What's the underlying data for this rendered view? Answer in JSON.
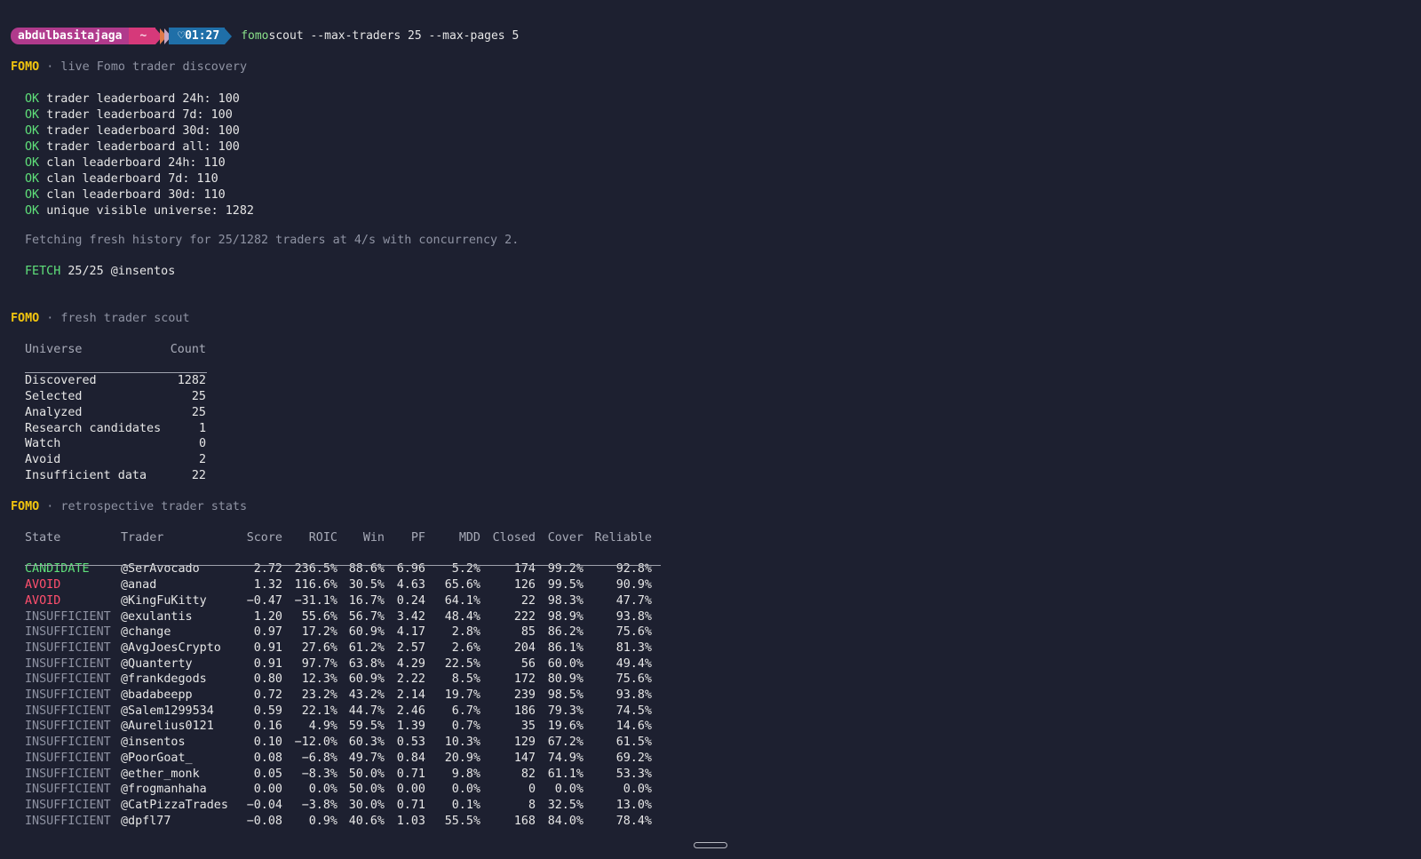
{
  "prompt": {
    "user": "abdulbasitajaga",
    "dir": "~",
    "time": "01:27",
    "command": "fomo",
    "args": " scout --max-traders 25 --max-pages 5"
  },
  "section1": {
    "brand": "FOMO",
    "title": " · live Fomo trader discovery"
  },
  "ok_lines": [
    "trader leaderboard 24h: 100",
    "trader leaderboard 7d: 100",
    "trader leaderboard 30d: 100",
    "trader leaderboard all: 100",
    "clan leaderboard 24h: 110",
    "clan leaderboard 7d: 110",
    "clan leaderboard 30d: 110",
    "unique visible universe: 1282"
  ],
  "ok_label": "OK",
  "fetch_info": "Fetching fresh history for 25/1282 traders at 4/s with concurrency 2.",
  "fetch": {
    "label": "FETCH",
    "text": " 25/25 @insentos"
  },
  "section2": {
    "brand": "FOMO",
    "title": " · fresh trader scout"
  },
  "universe": {
    "headers": [
      "Universe",
      "Count"
    ],
    "rows": [
      [
        "Discovered",
        "1282"
      ],
      [
        "Selected",
        "25"
      ],
      [
        "Analyzed",
        "25"
      ],
      [
        "Research candidates",
        "1"
      ],
      [
        "Watch",
        "0"
      ],
      [
        "Avoid",
        "2"
      ],
      [
        "Insufficient data",
        "22"
      ]
    ]
  },
  "section3": {
    "brand": "FOMO",
    "title": " · retrospective trader stats"
  },
  "stats": {
    "headers": [
      "State",
      "Trader",
      "Score",
      "ROIC",
      "Win",
      "PF",
      "MDD",
      "Closed",
      "Cover",
      "Reliable"
    ],
    "rows": [
      [
        "CANDIDATE",
        "@SerAvocado",
        "2.72",
        "236.5%",
        "88.6%",
        "6.96",
        "5.2%",
        "174",
        "99.2%",
        "92.8%"
      ],
      [
        "AVOID",
        "@anad",
        "1.32",
        "116.6%",
        "30.5%",
        "4.63",
        "65.6%",
        "126",
        "99.5%",
        "90.9%"
      ],
      [
        "AVOID",
        "@KingFuKitty",
        "−0.47",
        "−31.1%",
        "16.7%",
        "0.24",
        "64.1%",
        "22",
        "98.3%",
        "47.7%"
      ],
      [
        "INSUFFICIENT",
        "@exulantis",
        "1.20",
        "55.6%",
        "56.7%",
        "3.42",
        "48.4%",
        "222",
        "98.9%",
        "93.8%"
      ],
      [
        "INSUFFICIENT",
        "@change",
        "0.97",
        "17.2%",
        "60.9%",
        "4.17",
        "2.8%",
        "85",
        "86.2%",
        "75.6%"
      ],
      [
        "INSUFFICIENT",
        "@AvgJoesCrypto",
        "0.91",
        "27.6%",
        "61.2%",
        "2.57",
        "2.6%",
        "204",
        "86.1%",
        "81.3%"
      ],
      [
        "INSUFFICIENT",
        "@Quanterty",
        "0.91",
        "97.7%",
        "63.8%",
        "4.29",
        "22.5%",
        "56",
        "60.0%",
        "49.4%"
      ],
      [
        "INSUFFICIENT",
        "@frankdegods",
        "0.80",
        "12.3%",
        "60.9%",
        "2.22",
        "8.5%",
        "172",
        "80.9%",
        "75.6%"
      ],
      [
        "INSUFFICIENT",
        "@badabeepp",
        "0.72",
        "23.2%",
        "43.2%",
        "2.14",
        "19.7%",
        "239",
        "98.5%",
        "93.8%"
      ],
      [
        "INSUFFICIENT",
        "@Salem1299534",
        "0.59",
        "22.1%",
        "44.7%",
        "2.46",
        "6.7%",
        "186",
        "79.3%",
        "74.5%"
      ],
      [
        "INSUFFICIENT",
        "@Aurelius0121",
        "0.16",
        "4.9%",
        "59.5%",
        "1.39",
        "0.7%",
        "35",
        "19.6%",
        "14.6%"
      ],
      [
        "INSUFFICIENT",
        "@insentos",
        "0.10",
        "−12.0%",
        "60.3%",
        "0.53",
        "10.3%",
        "129",
        "67.2%",
        "61.5%"
      ],
      [
        "INSUFFICIENT",
        "@PoorGoat_",
        "0.08",
        "−6.8%",
        "49.7%",
        "0.84",
        "20.9%",
        "147",
        "74.9%",
        "69.2%"
      ],
      [
        "INSUFFICIENT",
        "@ether_monk",
        "0.05",
        "−8.3%",
        "50.0%",
        "0.71",
        "9.8%",
        "82",
        "61.1%",
        "53.3%"
      ],
      [
        "INSUFFICIENT",
        "@frogmanhaha",
        "0.00",
        "0.0%",
        "50.0%",
        "0.00",
        "0.0%",
        "0",
        "0.0%",
        "0.0%"
      ],
      [
        "INSUFFICIENT",
        "@CatPizzaTrades",
        "−0.04",
        "−3.8%",
        "30.0%",
        "0.71",
        "0.1%",
        "8",
        "32.5%",
        "13.0%"
      ],
      [
        "INSUFFICIENT",
        "@dpfl77",
        "−0.08",
        "0.9%",
        "40.6%",
        "1.03",
        "55.5%",
        "168",
        "84.0%",
        "78.4%"
      ]
    ]
  },
  "colors": {
    "background": "#1d2030",
    "brand": "#f1c40f",
    "ok": "#5fe07a",
    "avoid": "#ff4f6d",
    "dim": "#8f93a3",
    "prompt_user_bg": "#b03a8c",
    "prompt_dir_bg": "#d6397a",
    "prompt_time_bg": "#1f6fa8"
  }
}
